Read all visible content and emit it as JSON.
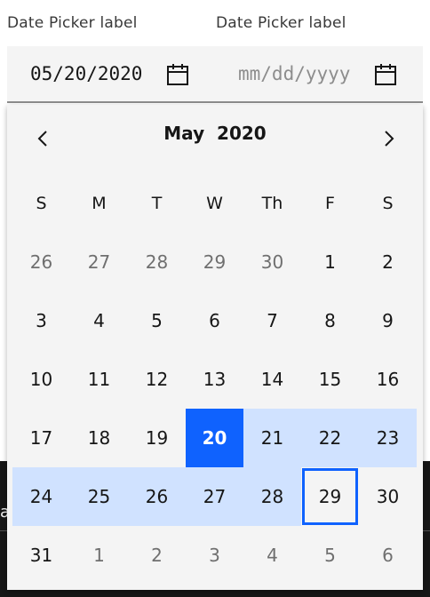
{
  "pickers": [
    {
      "label": "Date Picker label",
      "value": "05/20/2020",
      "placeholder": ""
    },
    {
      "label": "Date Picker label",
      "value": "",
      "placeholder": "mm/dd/yyyy"
    }
  ],
  "background_text": "a",
  "calendar": {
    "month": "May",
    "year": "2020",
    "weekdays": [
      "S",
      "M",
      "T",
      "W",
      "Th",
      "F",
      "S"
    ],
    "weeks": [
      [
        "26",
        "27",
        "28",
        "29",
        "30",
        "1",
        "2"
      ],
      [
        "3",
        "4",
        "5",
        "6",
        "7",
        "8",
        "9"
      ],
      [
        "10",
        "11",
        "12",
        "13",
        "14",
        "15",
        "16"
      ],
      [
        "17",
        "18",
        "19",
        "20",
        "21",
        "22",
        "23"
      ],
      [
        "24",
        "25",
        "26",
        "27",
        "28",
        "29",
        "30"
      ],
      [
        "31",
        "1",
        "2",
        "3",
        "4",
        "5",
        "6"
      ]
    ],
    "selected_day": "20",
    "highlighted_day": "29",
    "colors": {
      "accent": "#0f62fe",
      "range": "#d0e2ff",
      "surface": "#f4f4f4"
    }
  },
  "icons": {
    "prev": "chevron-left-icon",
    "next": "chevron-right-icon",
    "calendar": "calendar-icon"
  }
}
